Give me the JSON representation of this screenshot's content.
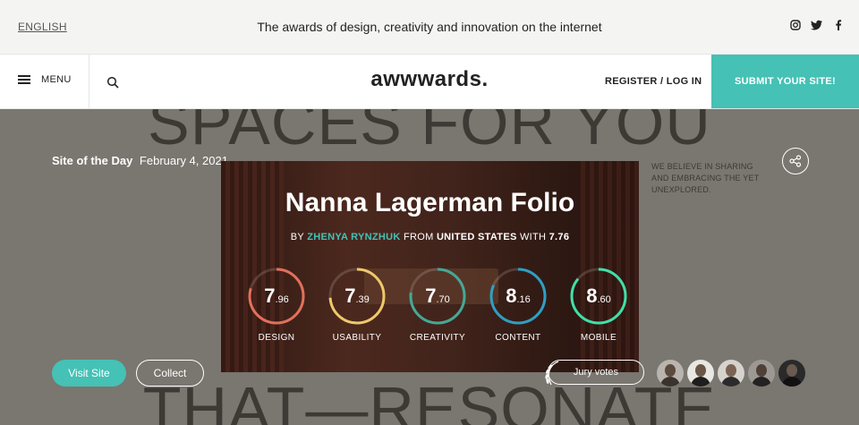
{
  "topbar": {
    "language": "ENGLISH",
    "tagline": "The awards of design, creativity and innovation on the internet",
    "social": [
      "instagram-icon",
      "twitter-icon",
      "facebook-icon"
    ]
  },
  "nav": {
    "menu_label": "MENU",
    "logo": "awwwards.",
    "register_label": "REGISTER / LOG IN",
    "submit_label": "SUBMIT YOUR SITE!"
  },
  "hero": {
    "bg_text_top": "SPACES FOR YOU",
    "bg_text_bottom": "THAT—RESONATE",
    "award_label": "Site of the Day",
    "award_date": "February 4, 2021",
    "belief_text": "WE BELIEVE IN SHARING AND EMBRACING THE YET UNEXPLORED.",
    "site_title": "Nanna Lagerman Folio",
    "by_prefix": "BY",
    "author": "ZHENYA RYNZHUK",
    "from_label": "FROM",
    "country": "UNITED STATES",
    "with_label": "WITH",
    "overall_score": "7.76",
    "scores": [
      {
        "label": "DESIGN",
        "int": "7",
        "dec": ".96",
        "value": 7.96,
        "color": "#e2705a"
      },
      {
        "label": "USABILITY",
        "int": "7",
        "dec": ".39",
        "value": 7.39,
        "color": "#efc86a"
      },
      {
        "label": "CREATIVITY",
        "int": "7",
        "dec": ".70",
        "value": 7.7,
        "color": "#45a896"
      },
      {
        "label": "CONTENT",
        "int": "8",
        "dec": ".16",
        "value": 8.16,
        "color": "#2e9fc4"
      },
      {
        "label": "MOBILE",
        "int": "8",
        "dec": ".60",
        "value": 8.6,
        "color": "#3fe0a8"
      }
    ],
    "visit_label": "Visit Site",
    "collect_label": "Collect",
    "jury_label": "Jury votes"
  },
  "colors": {
    "accent": "#45c1b5",
    "hero_bg": "#7a7670"
  }
}
